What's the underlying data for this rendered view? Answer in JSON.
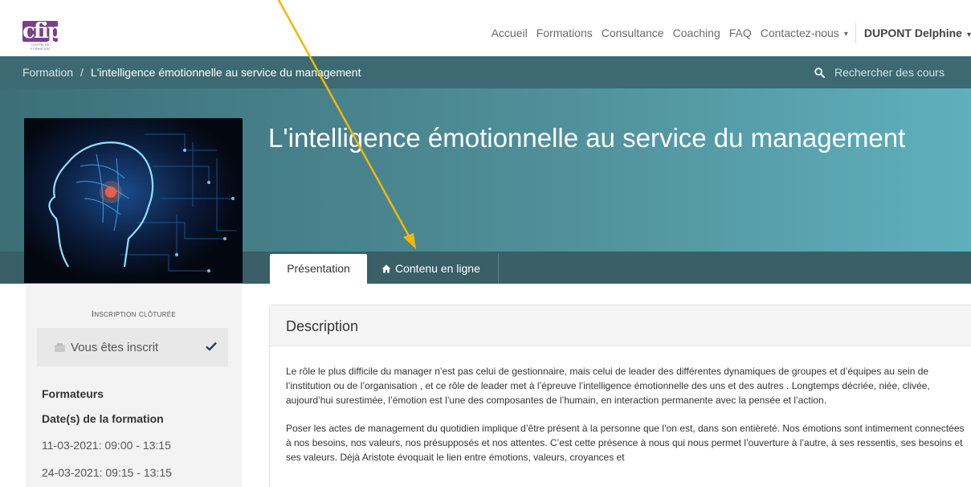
{
  "logo": {
    "text": "cfip",
    "tagline": "CENTRE DE FORMATION"
  },
  "nav": {
    "links": [
      "Accueil",
      "Formations",
      "Consultance",
      "Coaching",
      "FAQ"
    ],
    "contact": "Contactez-nous",
    "user": "DUPONT Delphine"
  },
  "breadcrumb": {
    "root": "Formation",
    "separator": "/",
    "current": "L'intelligence émotionnelle au service du management"
  },
  "search": {
    "placeholder": "Rechercher des cours",
    "icon": "search-icon"
  },
  "course": {
    "title": "L'intelligence émotionnelle au service du management"
  },
  "tabs": {
    "presentation": "Présentation",
    "online": "Contenu en ligne",
    "online_icon": "home-icon"
  },
  "sidebar": {
    "status": "Inscription clôturée",
    "enrolled": "Vous êtes inscrit",
    "trainers_heading": "Formateurs",
    "dates_heading": "Date(s) de la formation",
    "dates": [
      "11-03-2021: 09:00 - 13:15",
      "24-03-2021: 09:15 - 13:15"
    ]
  },
  "description": {
    "heading": "Description",
    "paragraphs": [
      "Le rôle le plus difficile du manager n’est pas celui de gestionnaire, mais celui de leader des différentes dynamiques de groupes et d’équipes au sein de l’institution ou de l’organisation , et ce rôle de leader met à l’épreuve l’intelligence émotionnelle des uns et des autres . Longtemps décriée, niée, clivée, aujourd’hui surestimée, l’émotion est l’une des composantes de l’humain, en interaction permanente avec la pensée et l’action.",
      "Poser les actes de management du quotidien implique d’être présent à la personne que l’on est, dans son entièreté. Nos émotions sont intimement connectées à nos besoins, nos valeurs, nos présupposés et nos attentes. C’est cette présence à nous qui nous permet l’ouverture à l’autre, à ses ressentis, ses besoins et ses valeurs. Déjà Aristote évoquait le lien entre émotions, valeurs, croyances et"
    ]
  },
  "colors": {
    "brand": "#7b3f8a",
    "breadcrumb_bar": "#3d6a72",
    "tab_strip": "#3a5f66",
    "annotation_arrow": "#f2b705"
  }
}
